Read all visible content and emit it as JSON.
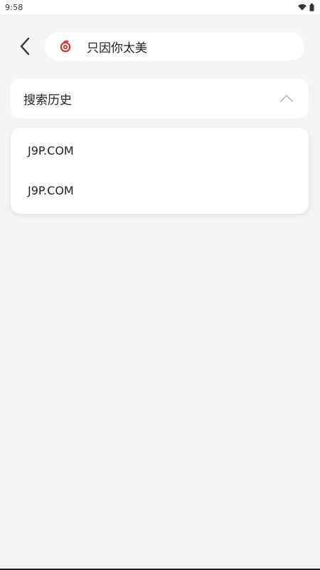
{
  "status_bar": {
    "time": "9:58"
  },
  "search": {
    "value": "只因你太美"
  },
  "history": {
    "title": "搜索历史",
    "items": [
      "J9P.COM",
      "J9P.COM"
    ]
  },
  "colors": {
    "accent": "#e0322b",
    "background": "#f4f4f6",
    "card": "#ffffff"
  },
  "icons": {
    "back": "chevron-left-icon",
    "logo": "netease-music-icon",
    "collapse": "chevron-up-icon",
    "wifi": "wifi-icon",
    "battery": "battery-icon"
  }
}
